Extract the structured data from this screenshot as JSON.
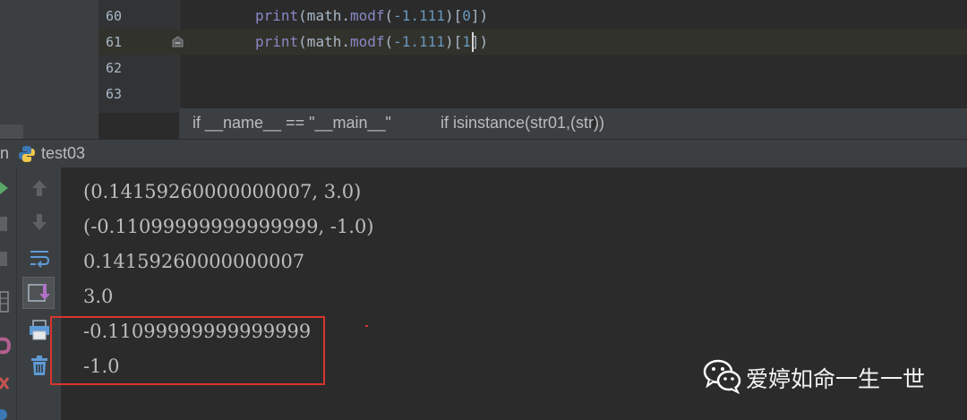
{
  "editor": {
    "lines": [
      {
        "number": "60",
        "code": {
          "fn": "print",
          "open": "(math.",
          "method": "modf",
          "arg_open": "(",
          "num": "-1.111",
          "close": ")[",
          "index": "0",
          "end": "])"
        }
      },
      {
        "number": "61",
        "code": {
          "fn": "print",
          "open": "(math.",
          "method": "modf",
          "arg_open": "(",
          "num": "-1.111",
          "close": ")[",
          "index": "1",
          "end": "])"
        }
      },
      {
        "number": "62"
      },
      {
        "number": "63"
      }
    ],
    "breadcrumbs": [
      "if __name__ == \"__main__\"",
      "if isinstance(str01,(str))"
    ]
  },
  "run_window": {
    "tab_prefix": "n",
    "config_name": "test03",
    "output": [
      "(0.14159260000000007, 3.0)",
      "(-0.11099999999999999, -1.0)",
      "0.14159260000000007",
      "3.0",
      "-0.11099999999999999",
      "-1.0"
    ]
  },
  "watermark": {
    "text": "爱婷如命一生一世",
    "icon": "wechat-icon"
  },
  "colors": {
    "highlight_box": "#d9352f",
    "run_green": "#59a869",
    "function": "#8888c6",
    "number": "#6897bb"
  }
}
